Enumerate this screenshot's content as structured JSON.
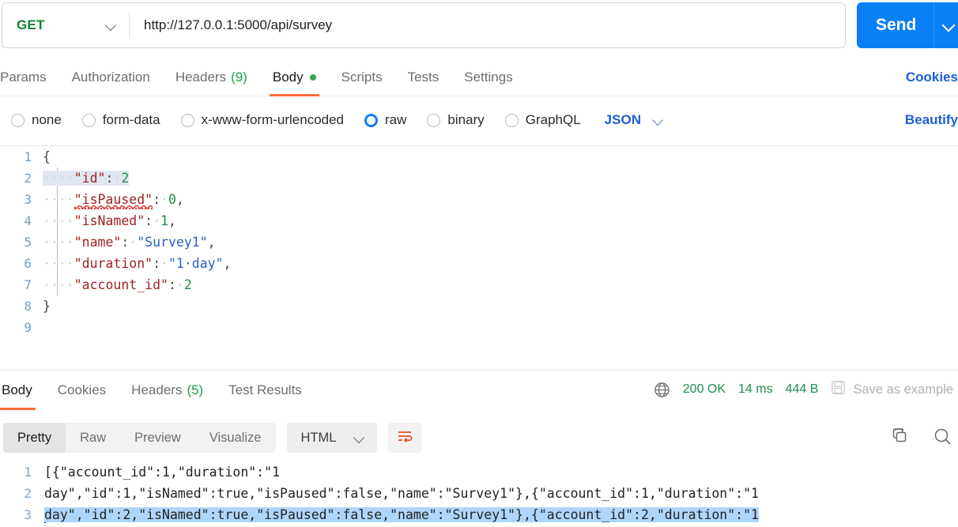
{
  "request": {
    "method": "GET",
    "url": "http://127.0.0.1:5000/api/survey",
    "send_label": "Send",
    "tabs": [
      {
        "label": "Params",
        "count": "",
        "active": false,
        "dot": false
      },
      {
        "label": "Authorization",
        "count": "",
        "active": false,
        "dot": false
      },
      {
        "label": "Headers",
        "count": "(9)",
        "active": false,
        "dot": false
      },
      {
        "label": "Body",
        "count": "",
        "active": true,
        "dot": true
      },
      {
        "label": "Scripts",
        "count": "",
        "active": false,
        "dot": false
      },
      {
        "label": "Tests",
        "count": "",
        "active": false,
        "dot": false
      },
      {
        "label": "Settings",
        "count": "",
        "active": false,
        "dot": false
      }
    ],
    "cookies_link": "Cookies",
    "beautify_link": "Beautify",
    "body_types": [
      {
        "label": "none",
        "selected": false
      },
      {
        "label": "form-data",
        "selected": false
      },
      {
        "label": "x-www-form-urlencoded",
        "selected": false
      },
      {
        "label": "raw",
        "selected": true
      },
      {
        "label": "binary",
        "selected": false
      },
      {
        "label": "GraphQL",
        "selected": false
      }
    ],
    "raw_format": "JSON",
    "editor": {
      "line_numbers": [
        "1",
        "2",
        "3",
        "4",
        "5",
        "6",
        "7",
        "8",
        "9"
      ],
      "lines": [
        {
          "n": "1",
          "text": "{"
        },
        {
          "n": "2",
          "text": "    \"id\": 2"
        },
        {
          "n": "3",
          "text": "    \"isPaused\": 0,"
        },
        {
          "n": "4",
          "text": "    \"isNamed\": 1,"
        },
        {
          "n": "5",
          "text": "    \"name\": \"Survey1\","
        },
        {
          "n": "6",
          "text": "    \"duration\": \"1 day\","
        },
        {
          "n": "7",
          "text": "    \"account_id\": 2"
        },
        {
          "n": "8",
          "text": "}"
        },
        {
          "n": "9",
          "text": ""
        }
      ],
      "json_object": {
        "id": 2,
        "isPaused": 0,
        "isNamed": 1,
        "name": "Survey1",
        "duration": "1 day",
        "account_id": 2
      }
    }
  },
  "response": {
    "tabs": [
      {
        "label": "Body",
        "count": "",
        "active": true
      },
      {
        "label": "Cookies",
        "count": "",
        "active": false
      },
      {
        "label": "Headers",
        "count": "(5)",
        "active": false
      },
      {
        "label": "Test Results",
        "count": "",
        "active": false
      }
    ],
    "status": "200 OK",
    "time": "14 ms",
    "size": "444 B",
    "save_as_example": "Save as example",
    "views": [
      {
        "label": "Pretty",
        "selected": true
      },
      {
        "label": "Raw",
        "selected": false
      },
      {
        "label": "Preview",
        "selected": false
      },
      {
        "label": "Visualize",
        "selected": false
      }
    ],
    "format": "HTML",
    "body_lines": [
      {
        "n": "1",
        "text": "[{\"account_id\":1,\"duration\":\"1"
      },
      {
        "n": "2",
        "text": "day\",\"id\":1,\"isNamed\":true,\"isPaused\":false,\"name\":\"Survey1\"},{\"account_id\":1,\"duration\":\"1"
      },
      {
        "n": "3",
        "text": "day\",\"id\":2,\"isNamed\":true,\"isPaused\":false,\"name\":\"Survey1\"},{\"account_id\":2,\"duration\":\"1"
      }
    ]
  },
  "colors": {
    "accent_orange": "#ff6c37",
    "send_blue": "#0b7ff5",
    "status_green": "#1b8f4a",
    "link_blue": "#1a5fd6",
    "method_green": "#0f8636"
  }
}
